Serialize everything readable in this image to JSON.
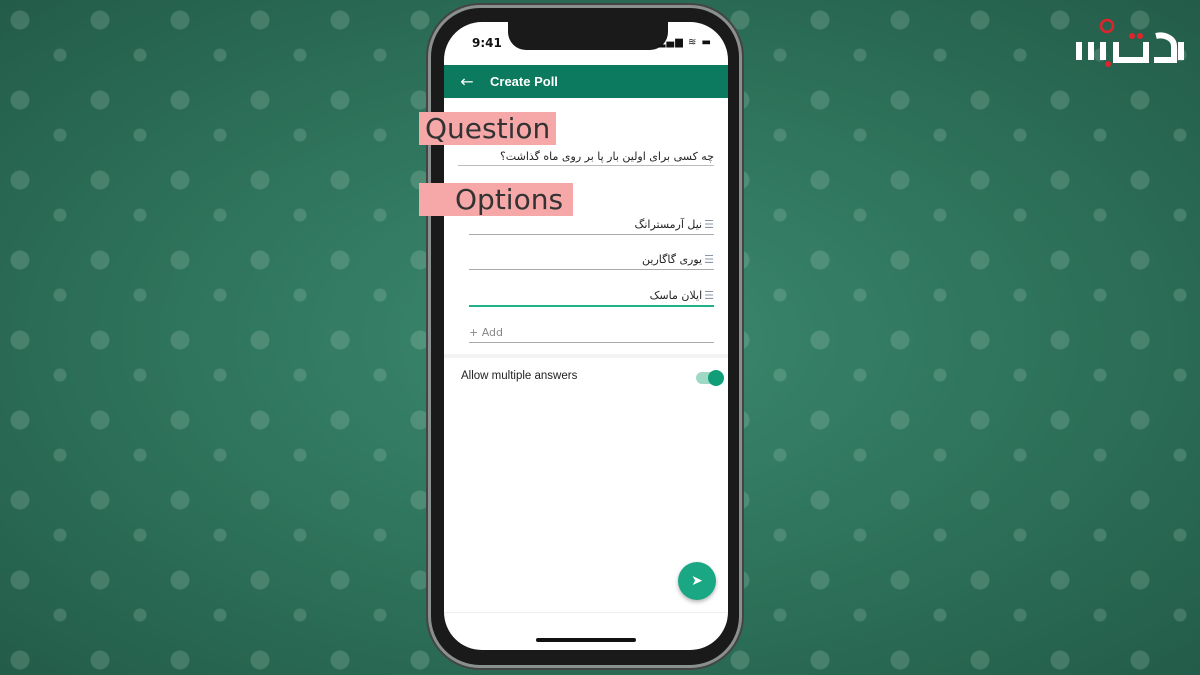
{
  "status_bar": {
    "time": "9:41",
    "icons": "▂▄▆ ≋ ▬"
  },
  "app_bar": {
    "back_icon": "←",
    "title": "Create Poll",
    "color": "#0b7a5e"
  },
  "labels": {
    "question": "Question",
    "options": "Options"
  },
  "question": {
    "value": "چه کسی برای اولین بار پا بر روی ماه گذاشت؟"
  },
  "options": [
    {
      "value": "نیل آرمسترانگ"
    },
    {
      "value": "یوری گاگارین"
    },
    {
      "value": "ایلان ماسک"
    }
  ],
  "add_option": "+ Add",
  "allow_multiple": {
    "label": "Allow multiple answers",
    "enabled": true
  },
  "send_icon": "➤",
  "logo": {
    "text": "آی‌تی‌بازار"
  }
}
